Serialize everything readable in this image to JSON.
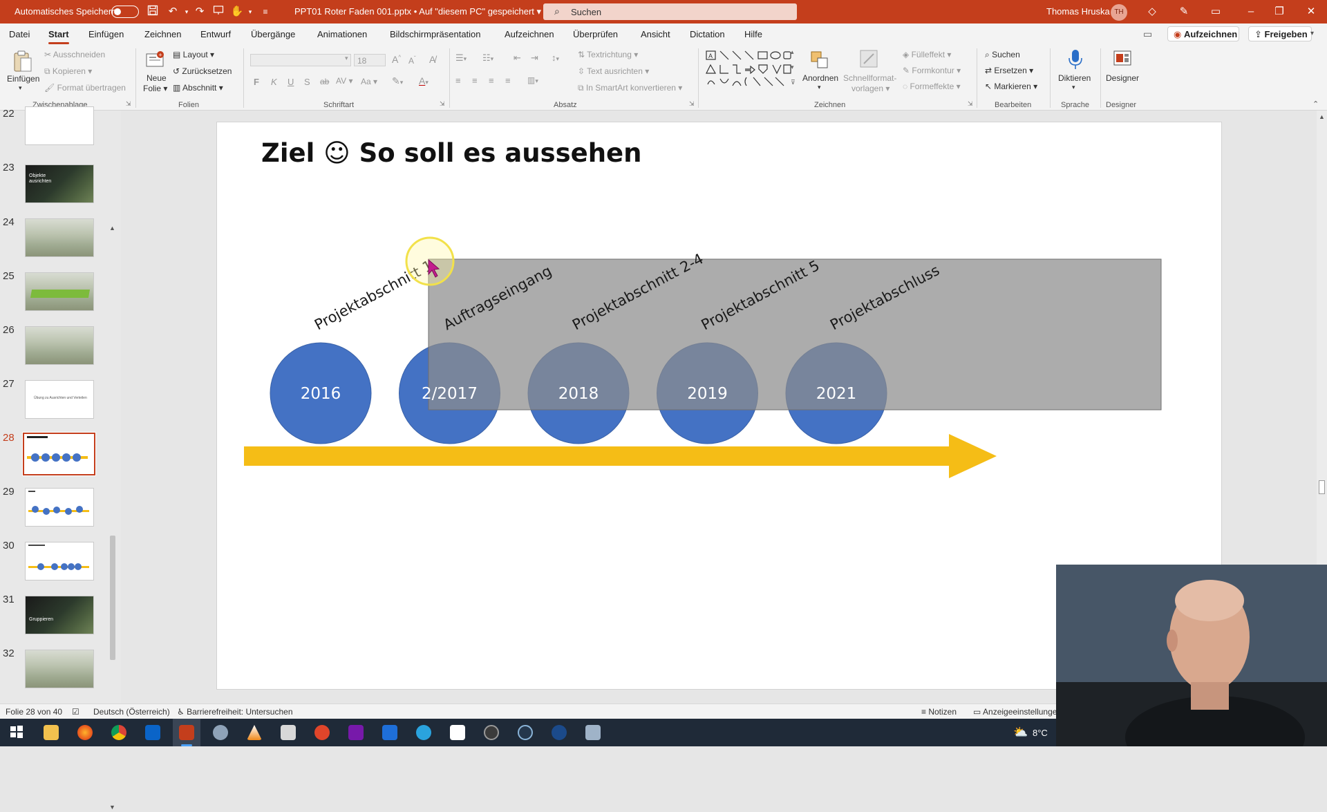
{
  "titlebar": {
    "autosave_label": "Automatisches Speichern",
    "doc_title": "PPT01 Roter Faden 001.pptx • Auf \"diesem PC\" gespeichert",
    "search_placeholder": "Suchen",
    "user_name": "Thomas Hruska",
    "user_initials": "TH",
    "accent": "#c43e1c"
  },
  "menu": {
    "items": [
      "Datei",
      "Start",
      "Einfügen",
      "Zeichnen",
      "Entwurf",
      "Übergänge",
      "Animationen",
      "Bildschirmpräsentation",
      "Aufzeichnen",
      "Überprüfen",
      "Ansicht",
      "Dictation",
      "Hilfe"
    ],
    "active": "Start",
    "record_button": "Aufzeichnen",
    "share_button": "Freigeben"
  },
  "ribbon": {
    "clipboard": {
      "paste": "Einfügen",
      "cut": "Ausschneiden",
      "copy": "Kopieren",
      "format_painter": "Format übertragen",
      "group": "Zwischenablage"
    },
    "slides": {
      "new_slide_1": "Neue",
      "new_slide_2": "Folie",
      "layout": "Layout",
      "reset": "Zurücksetzen",
      "section": "Abschnitt",
      "group": "Folien"
    },
    "font": {
      "size": "18",
      "bold": "F",
      "italic": "K",
      "underline": "U",
      "strike": "S",
      "group": "Schriftart"
    },
    "paragraph": {
      "text_direction": "Textrichtung",
      "align_text": "Text ausrichten",
      "smartart": "In SmartArt konvertieren",
      "group": "Absatz"
    },
    "drawing": {
      "arrange": "Anordnen",
      "quick_styles_1": "Schnellformat-",
      "quick_styles_2": "vorlagen",
      "fill": "Fülleffekt",
      "outline": "Formkontur",
      "effects": "Formeffekte",
      "group": "Zeichnen"
    },
    "editing": {
      "find": "Suchen",
      "replace": "Ersetzen",
      "select": "Markieren",
      "group": "Bearbeiten"
    },
    "voice": {
      "dictate": "Diktieren",
      "group": "Sprache"
    },
    "designer": {
      "label": "Designer",
      "group": "Designer"
    }
  },
  "slides_panel": {
    "numbers": [
      "22",
      "23",
      "24",
      "25",
      "26",
      "27",
      "28",
      "29",
      "30",
      "31",
      "32"
    ],
    "selected": "28",
    "thumb_23_text": "Objekte ausrichten",
    "thumb_27_text": "Übung zu Ausrichten und Verteilen",
    "thumb_31_text": "Gruppieren"
  },
  "slide": {
    "title": "Ziel ☺  So soll es aussehen",
    "milestone_labels": [
      "Projektabschnitt 1",
      "Auftragseingang",
      "Projektabschnitt 2-4",
      "Projektabschnitt 5",
      "Projektabschluss"
    ],
    "years": [
      "2016",
      "2/2017",
      "2018",
      "2019",
      "2021"
    ],
    "circle_color": "#4472c4",
    "arrow_color": "#f5bd16",
    "overlay_color": "#a6a6a6"
  },
  "statusbar": {
    "slide_count": "Folie 28 von 40",
    "language": "Deutsch (Österreich)",
    "accessibility": "Barrierefreiheit: Untersuchen",
    "notes": "Notizen",
    "display_settings": "Anzeigeeinstellunge"
  },
  "taskbar": {
    "temperature": "8°C"
  }
}
